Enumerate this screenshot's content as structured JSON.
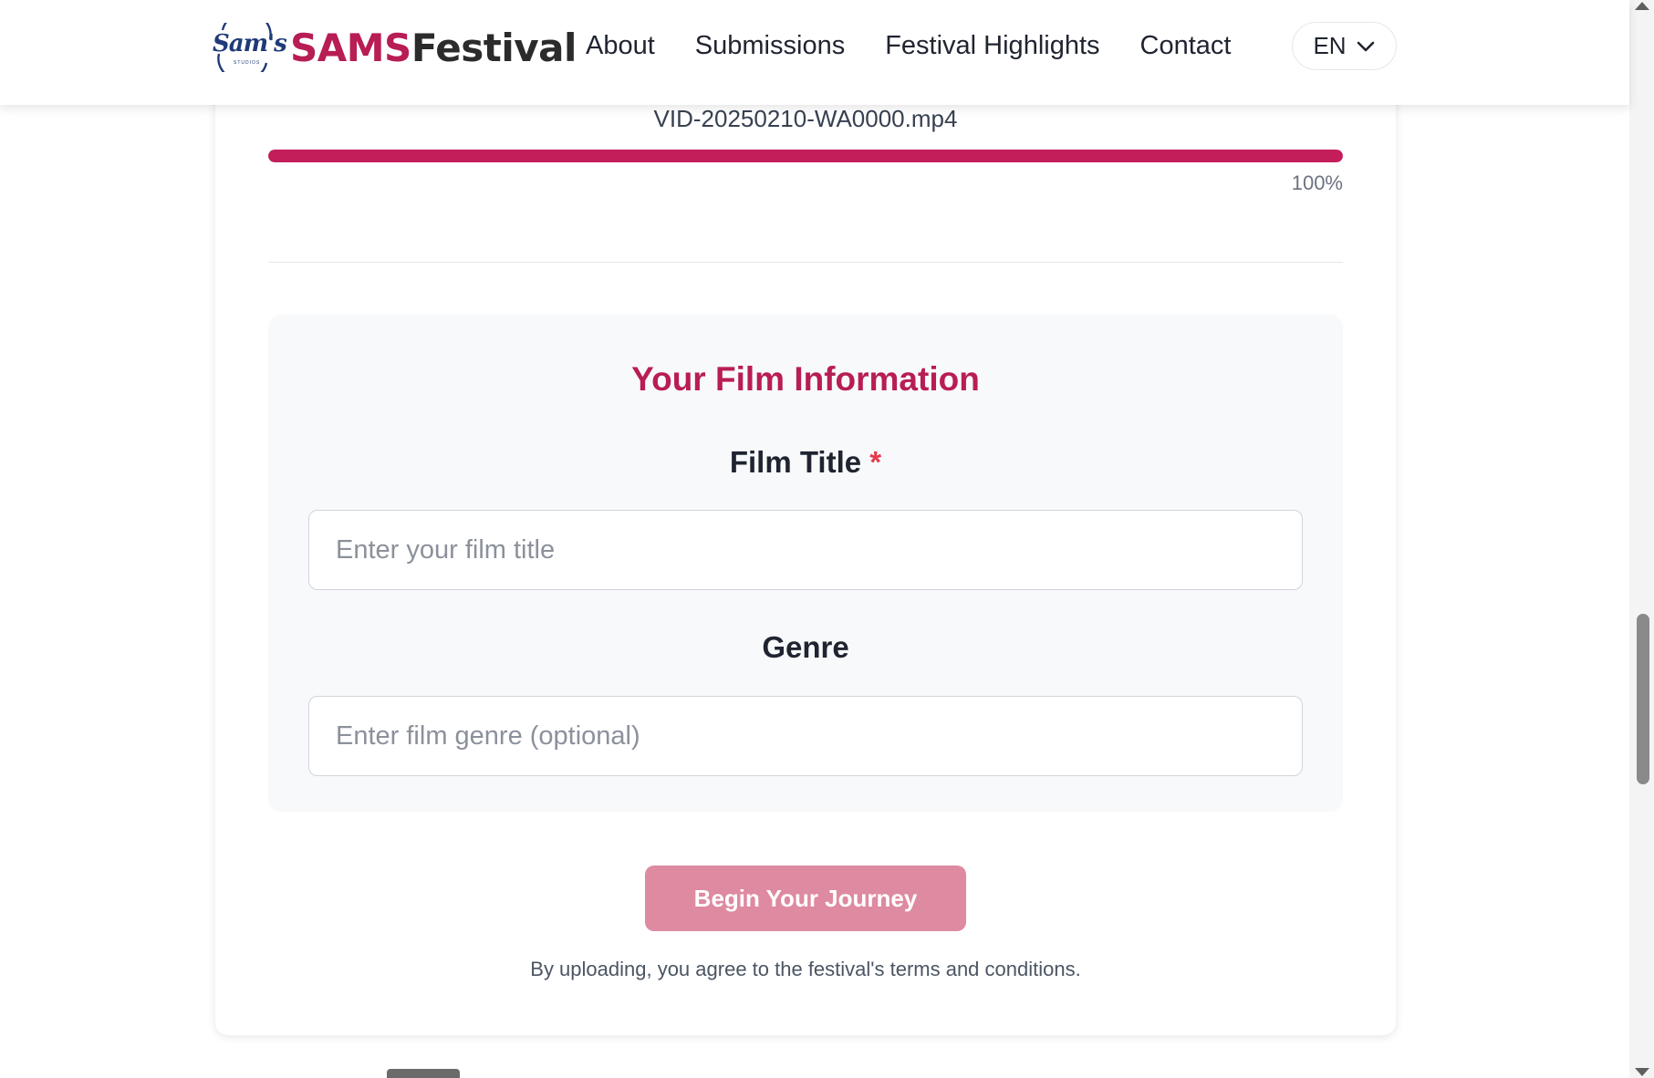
{
  "header": {
    "logo_text": "Sam's",
    "logo_subtext": "STUDIOS",
    "brand_part1": "SAMS",
    "brand_part2": "Festival",
    "nav": [
      {
        "label": "About"
      },
      {
        "label": "Submissions"
      },
      {
        "label": "Festival Highlights"
      },
      {
        "label": "Contact"
      }
    ],
    "language": "EN"
  },
  "upload": {
    "file_name": "VID-20250210-WA0000.mp4",
    "progress_value": 1.0,
    "progress_text": "100%"
  },
  "film_info": {
    "title": "Your Film Information",
    "film_title_label": "Film Title",
    "required_marker": "*",
    "film_title_placeholder": "Enter your film title",
    "genre_label": "Genre",
    "genre_placeholder": "Enter film genre (optional)"
  },
  "submit": {
    "button_label": "Begin Your Journey",
    "terms_text": "By uploading, you agree to the festival's terms and conditions."
  },
  "colors": {
    "brand_accent": "#b81d55",
    "progress_fill": "#c41e5a",
    "button_disabled": "#de8aa0",
    "required": "#e33b4a"
  },
  "icons": {
    "language_dropdown": "chevron-down-icon",
    "logo": "sams-studios-logo"
  }
}
